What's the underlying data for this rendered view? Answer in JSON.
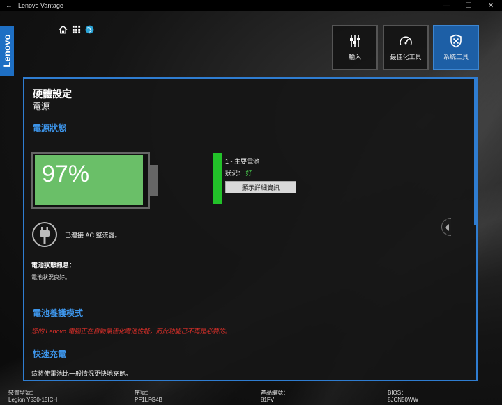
{
  "window": {
    "title": "Lenovo Vantage",
    "back_glyph": "←",
    "min_glyph": "—",
    "max_glyph": "☐",
    "close_glyph": "✕"
  },
  "logo": {
    "text": "Lenovo",
    "color": "#1e6fc4"
  },
  "top_icons": [
    "home-icon",
    "apps-grid-icon",
    "globe-icon"
  ],
  "tabs": [
    {
      "label": "輸入",
      "icon": "input-icon",
      "active": false
    },
    {
      "label": "最佳化工具",
      "icon": "speedometer-icon",
      "active": false
    },
    {
      "label": "系統工具",
      "icon": "tools-icon",
      "active": true
    }
  ],
  "page": {
    "title": "硬體設定",
    "subtitle": "電源"
  },
  "power_status": {
    "heading": "電源狀態",
    "battery_percent": "97%",
    "battery_level": 0.97,
    "battery_color": "#6abf68",
    "battery_name": "1 - 主要電池",
    "status_label": "狀況：",
    "status_value": "好",
    "details_button": "顯示詳細資訊",
    "ac_text": "已連接 AC 整流器。",
    "info_title": "電池狀態訊息：",
    "info_text": "電池狀況良好。"
  },
  "conservation": {
    "heading": "電池養護模式",
    "note": "您的 Lenovo 電腦正在自動最佳化電池性能，而此功能已不再是必要的。"
  },
  "rapid_charge": {
    "heading": "快速充電",
    "text": "這將使電池比一般情況更快地充飽。"
  },
  "footer": {
    "model_label": "裝置型號：",
    "model_value": "Legion Y530-15ICH",
    "serial_label": "序號：",
    "serial_value": "PF1LFG4B",
    "product_label": "產品編號：",
    "product_value": "81FV",
    "bios_label": "BIOS：",
    "bios_value": "8JCN50WW"
  }
}
